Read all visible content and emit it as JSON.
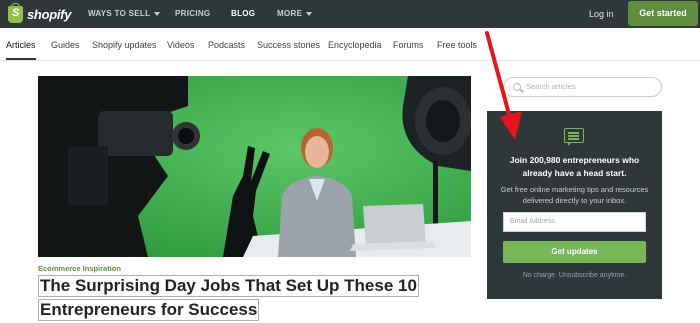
{
  "header": {
    "logo_text": "shopify",
    "nav": {
      "ways_to_sell": "WAYS TO SELL",
      "pricing": "PRICING",
      "blog": "BLOG",
      "more": "MORE"
    },
    "login": "Log in",
    "get_started": "Get started"
  },
  "subnav": {
    "items": [
      {
        "label": "Articles"
      },
      {
        "label": "Guides"
      },
      {
        "label": "Shopify updates"
      },
      {
        "label": "Videos"
      },
      {
        "label": "Podcasts"
      },
      {
        "label": "Success stories"
      },
      {
        "label": "Encyclopedia"
      },
      {
        "label": "Forums"
      },
      {
        "label": "Free tools"
      }
    ],
    "active": "Articles"
  },
  "article": {
    "category": "Ecommerce Inspiration",
    "title_line_1": "The Surprising Day Jobs That Set Up These 10",
    "title_line_2": "Entrepreneurs for Success"
  },
  "sidebar": {
    "search_placeholder": "Search articles",
    "signup": {
      "headline_1": "Join 200,980 entrepreneurs who",
      "headline_2": "already have a head start.",
      "sub_1": "Get free online marketing tips and resources",
      "sub_2": "delivered directly to your inbox.",
      "email_placeholder": "Email Address",
      "button": "Get updates",
      "footnote": "No charge. Unsubscribe anytime."
    }
  },
  "colors": {
    "topbar": "#30373b",
    "brand_green": "#5e8e3e",
    "accent_green": "#79b559",
    "annotation_red": "#e8141c"
  }
}
